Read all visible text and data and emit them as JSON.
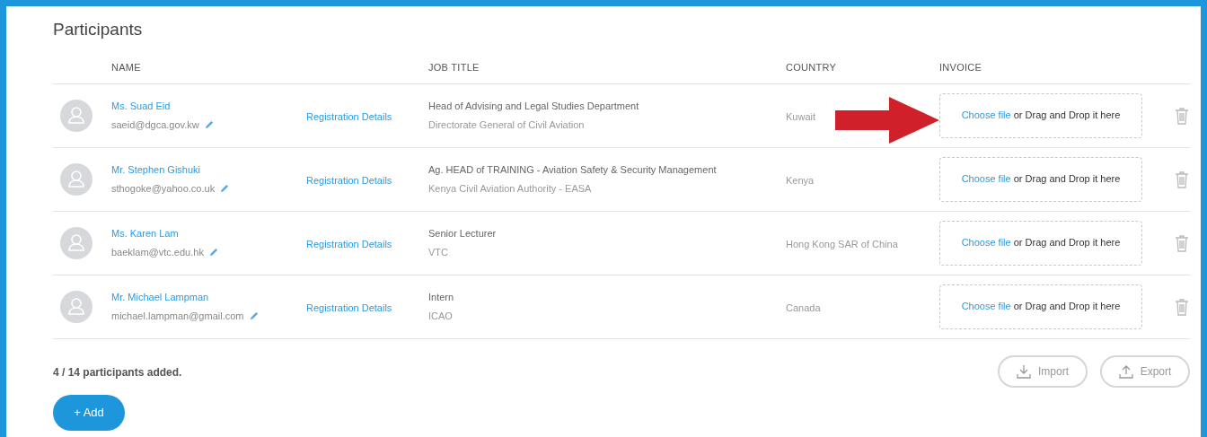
{
  "title": "Participants",
  "columns": [
    "NAME",
    "",
    "JOB TITLE",
    "COUNTRY",
    "INVOICE"
  ],
  "rows": [
    {
      "name": "Ms. Suad Eid",
      "email": "saeid@dgca.gov.kw",
      "link": "Registration Details",
      "job_title": "Head of Advising and Legal Studies Department",
      "organization": "Directorate General of Civil Aviation",
      "country": "Kuwait",
      "upload_link": "Choose file",
      "upload_text": "or Drag and Drop it here"
    },
    {
      "name": "Mr. Stephen Gishuki",
      "email": "sthogoke@yahoo.co.uk",
      "link": "Registration Details",
      "job_title": "Ag. HEAD of TRAINING - Aviation Safety & Security Management",
      "organization": "Kenya Civil Aviation Authority - EASA",
      "country": "Kenya",
      "upload_link": "Choose file",
      "upload_text": "or Drag and Drop it here"
    },
    {
      "name": "Ms. Karen Lam",
      "email": "baeklam@vtc.edu.hk",
      "link": "Registration Details",
      "job_title": "Senior Lecturer",
      "organization": "VTC",
      "country": "Hong Kong SAR of China",
      "upload_link": "Choose file",
      "upload_text": "or Drag and Drop it here"
    },
    {
      "name": "Mr. Michael Lampman",
      "email": "michael.lampman@gmail.com",
      "link": "Registration Details",
      "job_title": "Intern",
      "organization": "ICAO",
      "country": "Canada",
      "upload_link": "Choose file",
      "upload_text": "or Drag and Drop it here"
    }
  ],
  "summary": "4 / 14 participants added.",
  "add_button": "+ Add",
  "actions": [
    "Import",
    "Export"
  ],
  "annotation": {
    "kind": "arrow",
    "color": "#d0202a"
  }
}
